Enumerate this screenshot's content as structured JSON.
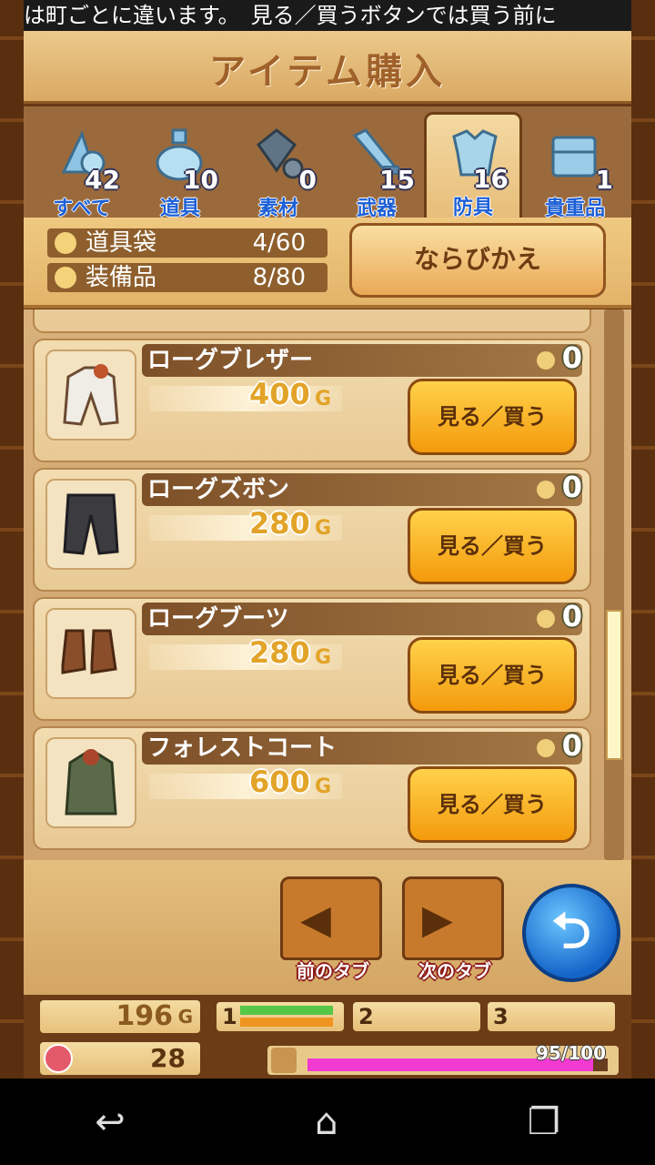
{
  "ticker": "は町ごとに違います。　見る／買うボタンでは買う前に",
  "title": "アイテム購入",
  "tabs": [
    {
      "label": "すべて",
      "count": "42"
    },
    {
      "label": "道具",
      "count": "10"
    },
    {
      "label": "素材",
      "count": "0"
    },
    {
      "label": "武器",
      "count": "15"
    },
    {
      "label": "防具",
      "count": "16"
    },
    {
      "label": "貴重品",
      "count": "1"
    }
  ],
  "bag": {
    "label": "道具袋",
    "value": "4/60"
  },
  "equip": {
    "label": "装備品",
    "value": "8/80"
  },
  "sort_label": "ならびかえ",
  "items": [
    {
      "name": "ローグブレザー",
      "price": "400",
      "owned": "0",
      "button": "見る／買う"
    },
    {
      "name": "ローグズボン",
      "price": "280",
      "owned": "0",
      "button": "見る／買う"
    },
    {
      "name": "ローグブーツ",
      "price": "280",
      "owned": "0",
      "button": "見る／買う"
    },
    {
      "name": "フォレストコート",
      "price": "600",
      "owned": "0",
      "button": "見る／買う"
    }
  ],
  "currency": "G",
  "nav": {
    "prev": "前のタブ",
    "next": "次のタブ"
  },
  "status": {
    "gold": "196",
    "hearts": "28",
    "party": [
      "1",
      "2",
      "3"
    ],
    "exp": "95/100"
  },
  "exp_ratio": 0.95
}
